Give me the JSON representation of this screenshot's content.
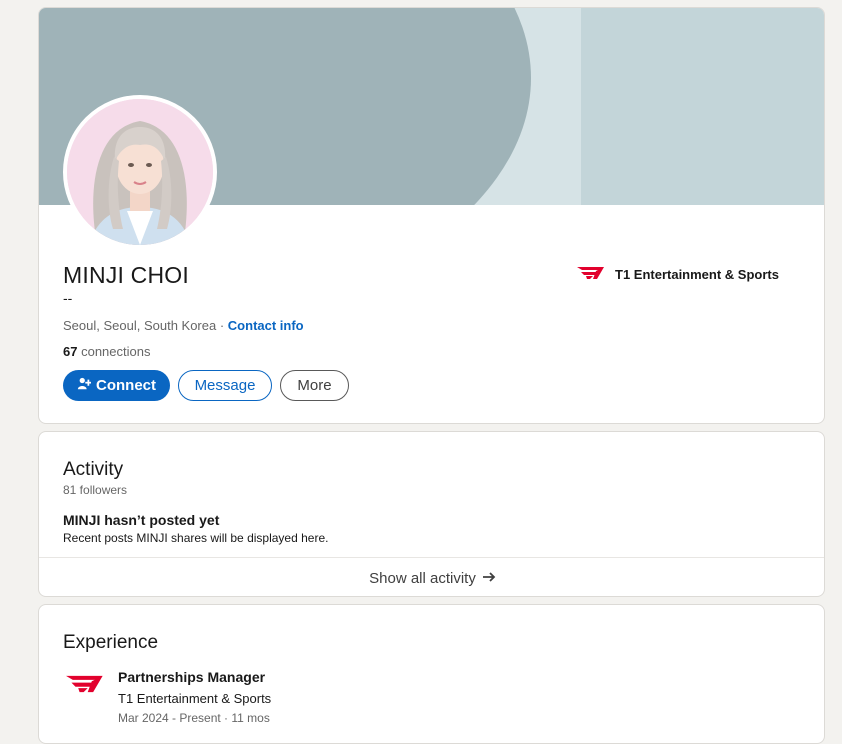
{
  "profile": {
    "name": "MINJI CHOI",
    "headline": "--",
    "location": "Seoul, Seoul, South Korea ·",
    "contact_info": "Contact info",
    "connections_count": "67",
    "connections_label": "connections",
    "company": "T1 Entertainment & Sports"
  },
  "actions": {
    "connect": "Connect",
    "message": "Message",
    "more": "More"
  },
  "activity": {
    "title": "Activity",
    "followers": "81 followers",
    "no_posts_title": "MINJI hasn’t posted yet",
    "no_posts_sub": "Recent posts MINJI shares will be displayed here.",
    "show_all": "Show all activity"
  },
  "experience": {
    "title": "Experience",
    "items": [
      {
        "role": "Partnerships Manager",
        "company": "T1 Entertainment & Sports",
        "dates": "Mar 2024 - Present · 11 mos"
      }
    ]
  },
  "colors": {
    "accent": "#0a66c2",
    "t1_red": "#e2012d",
    "banner_dark": "#9fb3b8",
    "banner_light": "#c3d5d9"
  },
  "icons": {
    "connect": "add-person-icon",
    "show_all": "arrow-right-icon",
    "company_logo": "t1-logo-icon"
  }
}
